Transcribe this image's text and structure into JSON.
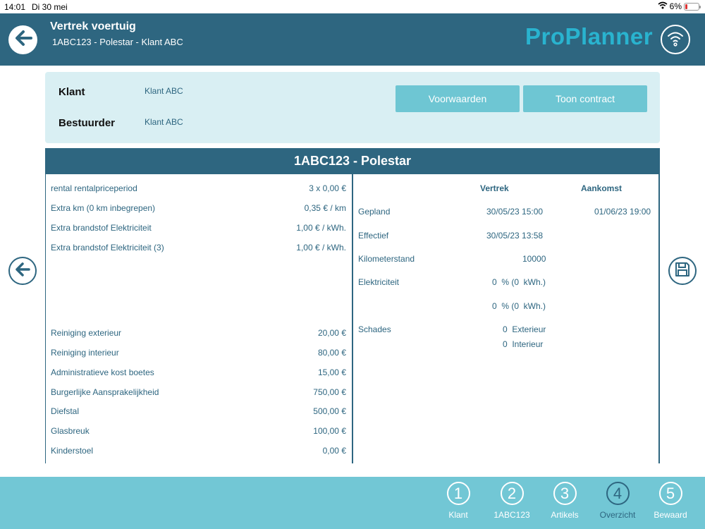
{
  "status_bar": {
    "time": "14:01",
    "date": "Di 30 mei",
    "battery": "6%"
  },
  "header": {
    "title": "Vertrek voertuig",
    "subtitle": "1ABC123 -  Polestar - Klant ABC",
    "logo": "ProPlanner",
    "back_icon": "arrow-left-icon",
    "connection_icon": "wifi-icon"
  },
  "info": {
    "klant_label": "Klant",
    "klant_value": "Klant ABC",
    "bestuurder_label": "Bestuurder",
    "bestuurder_value": "Klant ABC",
    "btn_voorwaarden": "Voorwaarden",
    "btn_contract": "Toon contract"
  },
  "vehicle_title": "1ABC123 - Polestar",
  "pricing_top": [
    {
      "label": "rental rentalpriceperiod",
      "value": "3 x 0,00 €"
    },
    {
      "label": "Extra km (0 km inbegrepen)",
      "value": "0,35 € / km"
    },
    {
      "label": "Extra brandstof  Elektriciteit",
      "value": "1,00 € / kWh."
    },
    {
      "label": "Extra brandstof  Elektriciteit (3)",
      "value": "1,00 € / kWh."
    }
  ],
  "pricing_bottom": [
    {
      "label": "Reiniging exterieur",
      "value": "20,00 €"
    },
    {
      "label": "Reiniging interieur",
      "value": "80,00 €"
    },
    {
      "label": "Administratieve kost boetes",
      "value": "15,00 €"
    },
    {
      "label": "Burgerlijke Aansprakelijkheid",
      "value": "750,00 €"
    },
    {
      "label": "Diefstal",
      "value": "500,00 €"
    },
    {
      "label": "Glasbreuk",
      "value": "100,00 €"
    },
    {
      "label": "Kinderstoel",
      "value": "0,00 €"
    }
  ],
  "details": {
    "col_vertrek": "Vertrek",
    "col_aankomst": "Aankomst",
    "gepland_label": "Gepland",
    "gepland_vertrek": "30/05/23 15:00",
    "gepland_aankomst": "01/06/23 19:00",
    "effectief_label": "Effectief",
    "effectief_vertrek": "30/05/23 13:58",
    "km_label": "Kilometerstand",
    "km_value": "10000",
    "elek_label": "Elektriciteit",
    "elek_value1": "0  % (0  kWh.)",
    "elek_value2": "0  % (0  kWh.)",
    "schades_label": "Schades",
    "schades_ext": "0  Exterieur",
    "schades_int": "0  Interieur"
  },
  "side": {
    "back_icon": "arrow-left-icon",
    "save_icon": "save-icon"
  },
  "steps": [
    {
      "num": "1",
      "label": "Klant"
    },
    {
      "num": "2",
      "label": "1ABC123"
    },
    {
      "num": "3",
      "label": "Artikels"
    },
    {
      "num": "4",
      "label": "Overzicht"
    },
    {
      "num": "5",
      "label": "Bewaard"
    }
  ],
  "active_step": "4",
  "colors": {
    "primary": "#2e6680",
    "accent": "#72c7d5",
    "panel": "#d9eff3",
    "logo": "#29b3cf"
  }
}
